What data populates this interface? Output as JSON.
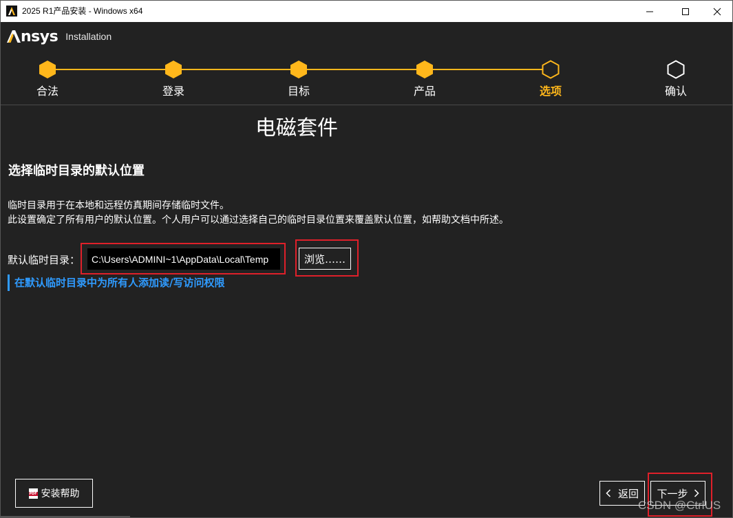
{
  "window": {
    "title": "2025 R1产品安装 - Windows x64",
    "controls": {
      "minimize": "—",
      "maximize": "☐",
      "close": "✕"
    }
  },
  "brand": {
    "logo_mark": "A",
    "logo_text": "nsys",
    "subtitle": "Installation",
    "accent_color": "#ffb71b"
  },
  "steps": [
    {
      "label": "合法",
      "state": "done"
    },
    {
      "label": "登录",
      "state": "done"
    },
    {
      "label": "目标",
      "state": "done"
    },
    {
      "label": "产品",
      "state": "done"
    },
    {
      "label": "选项",
      "state": "active"
    },
    {
      "label": "确认",
      "state": "pending"
    }
  ],
  "main": {
    "product_title": "电磁套件",
    "section_heading": "选择临时目录的默认位置",
    "description_line1": "临时目录用于在本地和远程仿真期间存储临时文件。",
    "description_line2": "此设置确定了所有用户的默认位置。个人用户可以通过选择自己的临时目录位置来覆盖默认位置，如帮助文档中所述。",
    "temp_dir_label": "默认临时目录：",
    "temp_dir_value": "C:\\Users\\ADMINI~1\\AppData\\Local\\Temp",
    "browse_label": "浏览……",
    "permission_link": "在默认临时目录中为所有人添加读/写访问权限",
    "link_color": "#2f9bff"
  },
  "footer": {
    "help_label": "安装帮助",
    "back_label": "返回",
    "next_label": "下一步",
    "pdf_icon_text": "PDF"
  },
  "watermark": "CSDN @CtrlUS",
  "annotation_color": "#e0202a"
}
